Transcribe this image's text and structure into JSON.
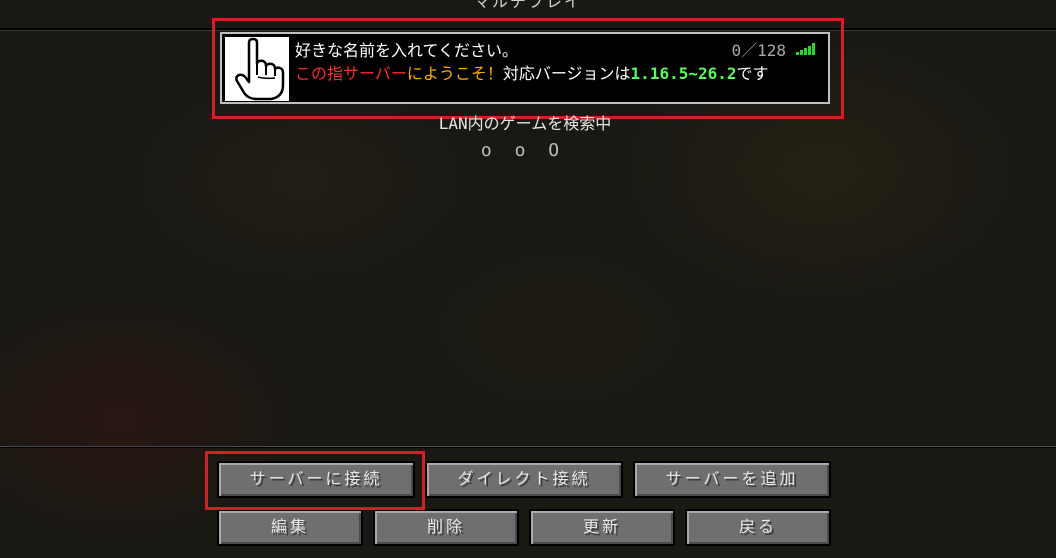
{
  "screen": {
    "title": "マルチプレイ",
    "lan_status": "LAN内のゲームを検索中",
    "lan_animation": "o o O"
  },
  "server": {
    "name": "好きな名前を入れてください。",
    "player_count": "0／128",
    "motd": {
      "part1": "この指サーバー",
      "part2": "にようこそ！",
      "part3": "対応バージョンは",
      "part4": "1.16.5~26.2",
      "part5": "です"
    },
    "icon": "pointing-hand-icon",
    "ping_icon": "signal-bars-icon",
    "colors": {
      "motd_red": "#ff2a2a",
      "motd_gold": "#ffaa00",
      "version_green": "#55ff55",
      "ping_green": "#2bd52b"
    }
  },
  "buttons": {
    "join": "サーバーに接続",
    "direct": "ダイレクト接続",
    "add": "サーバーを追加",
    "edit": "編集",
    "delete": "削除",
    "refresh": "更新",
    "back": "戻る"
  }
}
